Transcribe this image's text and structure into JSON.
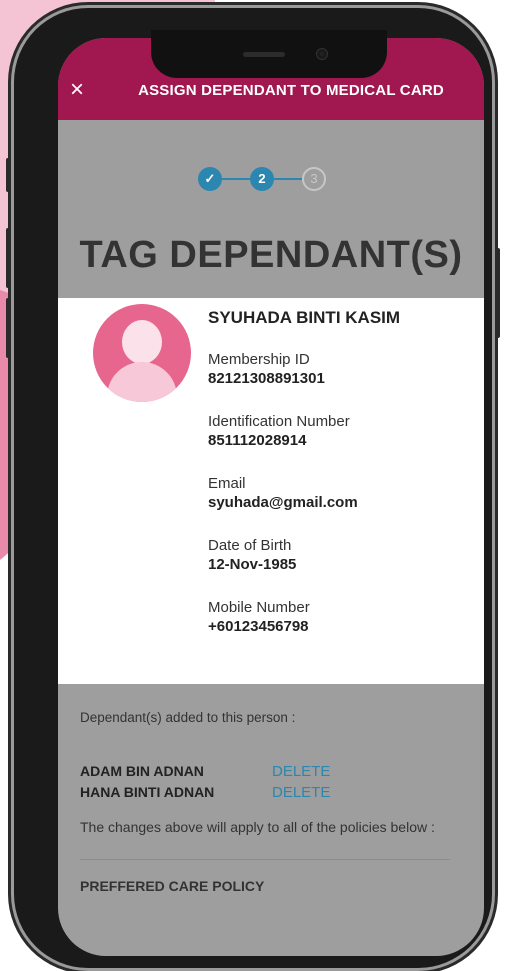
{
  "header": {
    "close_icon": "×",
    "title": "ASSIGN DEPENDANT TO MEDICAL CARD"
  },
  "stepper": {
    "step1": "✓",
    "step2": "2",
    "step3": "3",
    "current_step": 2
  },
  "page_title": "TAG DEPENDANT(S)",
  "profile": {
    "name": "SYUHADA BINTI KASIM",
    "membership_label": "Membership ID",
    "membership_value": "82121308891301",
    "id_label": "Identification Number",
    "id_value": "851112028914",
    "email_label": "Email",
    "email_value": "syuhada@gmail.com",
    "dob_label": "Date of Birth",
    "dob_value": "12-Nov-1985",
    "mobile_label": "Mobile Number",
    "mobile_value": "+60123456798"
  },
  "dependants": {
    "intro": "Dependant(s) added to this person :",
    "items": [
      {
        "name": "ADAM BIN ADNAN",
        "action": "DELETE"
      },
      {
        "name": "HANA BINTI ADNAN",
        "action": "DELETE"
      }
    ],
    "changes_note": "The changes above will apply to all of the policies below :",
    "policy_title": "PREFFERED CARE POLICY"
  },
  "colors": {
    "header": "#a0184f",
    "accent": "#2b86b0",
    "avatar": "#e6668e"
  }
}
